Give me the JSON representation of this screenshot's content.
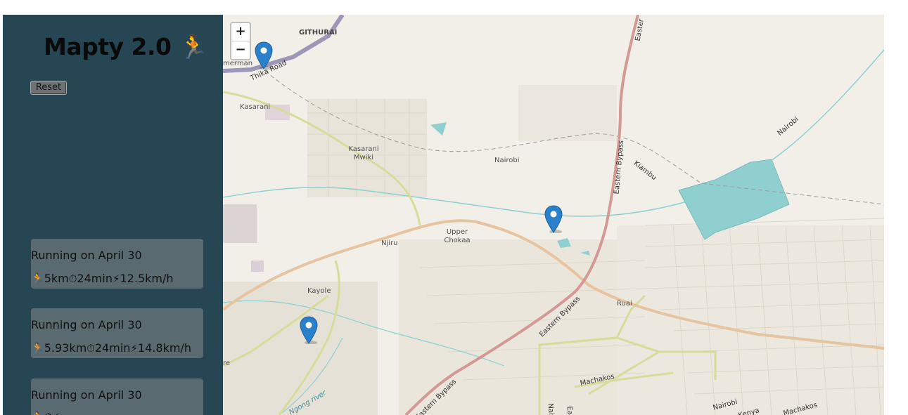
{
  "app": {
    "title": "Mapty 2.0 🏃",
    "reset_label": "Reset"
  },
  "workouts": [
    {
      "title": "Running on April 30",
      "icon": "🏃",
      "distance": "5km",
      "clock": "⏱",
      "duration": "24min",
      "bolt": "⚡",
      "speed": "12.5km/h"
    },
    {
      "title": "Running on April 30",
      "icon": "🏃",
      "distance": "5.93km",
      "clock": "⏱",
      "duration": "24min",
      "bolt": "⚡",
      "speed": "14.8km/h"
    },
    {
      "title": "Running on April 30",
      "icon": "🏃",
      "distance": "",
      "clock": "⏱",
      "duration": "",
      "bolt": "⚡",
      "speed": ""
    }
  ],
  "map": {
    "zoom_in": "+",
    "zoom_out": "−",
    "places": [
      "GITHURAI",
      "Kasarani",
      "Kasarani Mwiki",
      "Nairobi",
      "Njiru",
      "Upper Chokaa",
      "Kayole",
      "Ruai",
      "Machakos",
      "Kiambu",
      "Nairobi",
      "merman",
      "re"
    ],
    "roads": [
      "Thika Road",
      "Eastern Bypass",
      "Eastern Bypass",
      "Eastern Bypass",
      "Easter",
      "Nairobi",
      "Kenya",
      "Machakos",
      "Nairo",
      "East"
    ],
    "rivers": [
      "Ngong river"
    ],
    "colors": {
      "sidebar": "#264653",
      "card": "#5a6a71",
      "marker": "#2a81cb",
      "trunk": "#d49995",
      "primary": "#e6c3a1",
      "secondary": "#d6dd9a",
      "water": "#8fcfd0"
    }
  }
}
